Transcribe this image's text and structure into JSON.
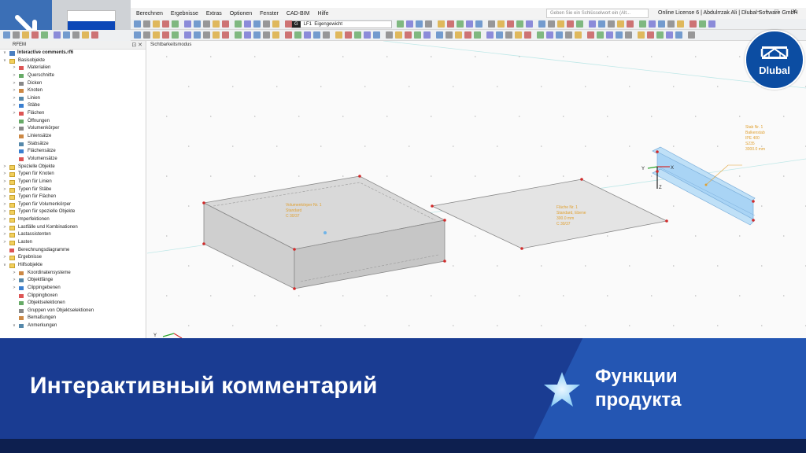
{
  "menu": {
    "items": [
      "Berechnen",
      "Ergebnisse",
      "Extras",
      "Optionen",
      "Fenster",
      "CAD-BIM",
      "Hilfe"
    ],
    "search_placeholder": "Geben Sie ein Schlüsselwort ein (Alt...",
    "license": "Online License 6 | Abdulrrzak Ali | Dlubal Software GmbH"
  },
  "toolbar": {
    "load_case_tag": "G",
    "load_case_id": "LF1",
    "load_case_name": "Eigengewicht"
  },
  "panel": {
    "title": "RFEM",
    "file": "Interactive comments.rf6"
  },
  "tree": [
    {
      "label": "Basisobjekte",
      "level": 1,
      "expanded": true,
      "icon": "folder-icon"
    },
    {
      "label": "Materialien",
      "level": 2,
      "expanded": false,
      "icon": "material-icon"
    },
    {
      "label": "Querschnitte",
      "level": 2,
      "expanded": false,
      "icon": "section-icon"
    },
    {
      "label": "Dicken",
      "level": 2,
      "expanded": false,
      "icon": "thickness-icon"
    },
    {
      "label": "Knoten",
      "level": 2,
      "expanded": false,
      "icon": "node-icon"
    },
    {
      "label": "Linien",
      "level": 2,
      "expanded": false,
      "icon": "line-icon"
    },
    {
      "label": "Stäbe",
      "level": 2,
      "expanded": false,
      "icon": "member-icon"
    },
    {
      "label": "Flächen",
      "level": 2,
      "expanded": false,
      "icon": "surface-icon"
    },
    {
      "label": "Öffnungen",
      "level": 2,
      "expanded": null,
      "icon": "opening-icon"
    },
    {
      "label": "Volumenkörper",
      "level": 2,
      "expanded": false,
      "icon": "solid-icon"
    },
    {
      "label": "Liniensätze",
      "level": 2,
      "expanded": null,
      "icon": "line-set-icon"
    },
    {
      "label": "Stabsätze",
      "level": 2,
      "expanded": null,
      "icon": "member-set-icon"
    },
    {
      "label": "Flächensätze",
      "level": 2,
      "expanded": null,
      "icon": "surface-set-icon"
    },
    {
      "label": "Volumensätze",
      "level": 2,
      "expanded": null,
      "icon": "solid-set-icon"
    },
    {
      "label": "Spezielle Objekte",
      "level": 1,
      "expanded": false,
      "icon": "folder-icon"
    },
    {
      "label": "Typen für Knoten",
      "level": 1,
      "expanded": false,
      "icon": "folder-icon"
    },
    {
      "label": "Typen für Linien",
      "level": 1,
      "expanded": false,
      "icon": "folder-icon"
    },
    {
      "label": "Typen für Stäbe",
      "level": 1,
      "expanded": false,
      "icon": "folder-icon"
    },
    {
      "label": "Typen für Flächen",
      "level": 1,
      "expanded": false,
      "icon": "folder-icon"
    },
    {
      "label": "Typen für Volumenkörper",
      "level": 1,
      "expanded": false,
      "icon": "folder-icon"
    },
    {
      "label": "Typen für spezielle Objekte",
      "level": 1,
      "expanded": false,
      "icon": "folder-icon"
    },
    {
      "label": "Imperfektionen",
      "level": 1,
      "expanded": false,
      "icon": "folder-icon"
    },
    {
      "label": "Lastfälle und Kombinationen",
      "level": 1,
      "expanded": false,
      "icon": "folder-icon"
    },
    {
      "label": "Lastassistenten",
      "level": 1,
      "expanded": false,
      "icon": "folder-icon"
    },
    {
      "label": "Lasten",
      "level": 1,
      "expanded": false,
      "icon": "folder-icon"
    },
    {
      "label": "Berechnungsdiagramme",
      "level": 1,
      "expanded": null,
      "icon": "diagram-icon"
    },
    {
      "label": "Ergebnisse",
      "level": 1,
      "expanded": false,
      "icon": "folder-icon"
    },
    {
      "label": "Hilfsobjekte",
      "level": 1,
      "expanded": true,
      "icon": "folder-icon"
    },
    {
      "label": "Koordinatensysteme",
      "level": 2,
      "expanded": false,
      "icon": "coordinate-system-icon"
    },
    {
      "label": "Objektfänge",
      "level": 2,
      "expanded": false,
      "icon": "snap-icon"
    },
    {
      "label": "Clippingebenen",
      "level": 2,
      "expanded": false,
      "icon": "clipping-plane-icon"
    },
    {
      "label": "Clippingboxen",
      "level": 2,
      "expanded": null,
      "icon": "clipping-box-icon"
    },
    {
      "label": "Objektselektionen",
      "level": 2,
      "expanded": null,
      "icon": "selection-icon"
    },
    {
      "label": "Gruppen von Objektselektionen",
      "level": 2,
      "expanded": null,
      "icon": "selection-group-icon"
    },
    {
      "label": "Bemaßungen",
      "level": 2,
      "expanded": null,
      "icon": "dimension-icon"
    },
    {
      "label": "Anmerkungen",
      "level": 2,
      "expanded": true,
      "icon": "note-icon"
    }
  ],
  "viewport": {
    "mode_label": "Sichtbarkeitsmodus",
    "comments": {
      "solid": [
        "Volumenkörper Nr. 1",
        "Standard",
        "C 30/37"
      ],
      "surface": [
        "Fläche Nr. 1",
        "Standard, Ebene",
        "300.0 mm",
        "C 30/37"
      ],
      "member": [
        "Stab Nr. 1",
        "Balkenstab",
        "IPE 400",
        "S235",
        "3000.0 mm"
      ]
    },
    "axes": {
      "x": "X",
      "y": "Y",
      "z": "Z"
    }
  },
  "logo": {
    "text": "Dlubal"
  },
  "banner": {
    "title": "Интерактивный комментарий",
    "feature_line1": "Функции",
    "feature_line2": "продукта"
  },
  "colors": {
    "banner_dark": "#1a3c92",
    "banner_light": "#2456b3",
    "comment_text": "#e0a030",
    "node": "#d12a2a",
    "member_fill": "#a9d4f5",
    "logo_blue": "#0c4da2"
  }
}
